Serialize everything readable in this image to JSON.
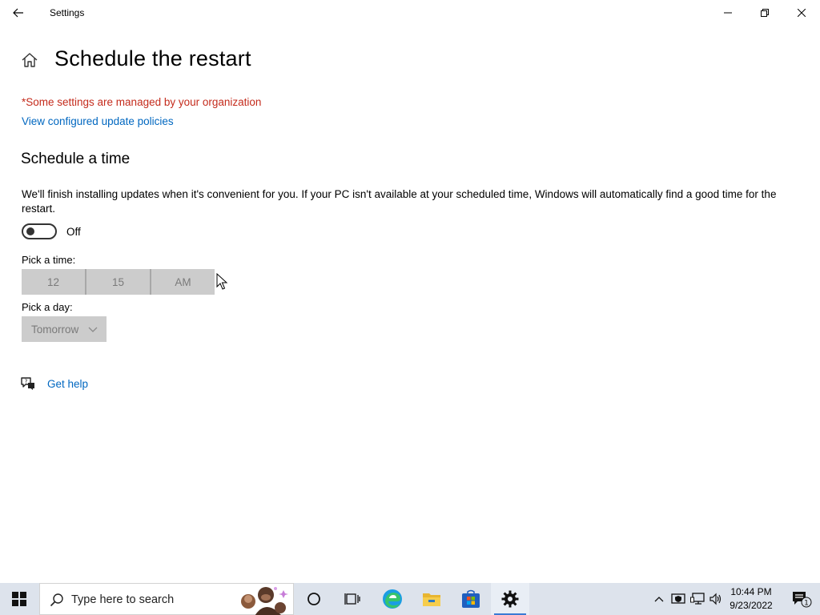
{
  "window": {
    "title": "Settings"
  },
  "page": {
    "title": "Schedule the restart",
    "managed_note": "*Some settings are managed by your organization",
    "policies_link": "View configured update policies"
  },
  "schedule": {
    "section_title": "Schedule a time",
    "description": "We'll finish installing updates when it's convenient for you. If your PC isn't available at your scheduled time, Windows will automatically find a good time for the restart.",
    "toggle_state": "Off",
    "toggle_on": false,
    "pick_time_label": "Pick a time:",
    "time": {
      "hour": "12",
      "minute": "15",
      "period": "AM"
    },
    "pick_day_label": "Pick a day:",
    "day": "Tomorrow"
  },
  "help": {
    "label": "Get help"
  },
  "taskbar": {
    "search_placeholder": "Type here to search",
    "clock_time": "10:44 PM",
    "clock_date": "9/23/2022",
    "notification_count": "1"
  },
  "colors": {
    "accent": "#0067c0",
    "warning": "#c42b1c",
    "disabled_bg": "#cccccc",
    "disabled_text": "#7a7a7a",
    "taskbar_bg": "#dde3ec"
  }
}
